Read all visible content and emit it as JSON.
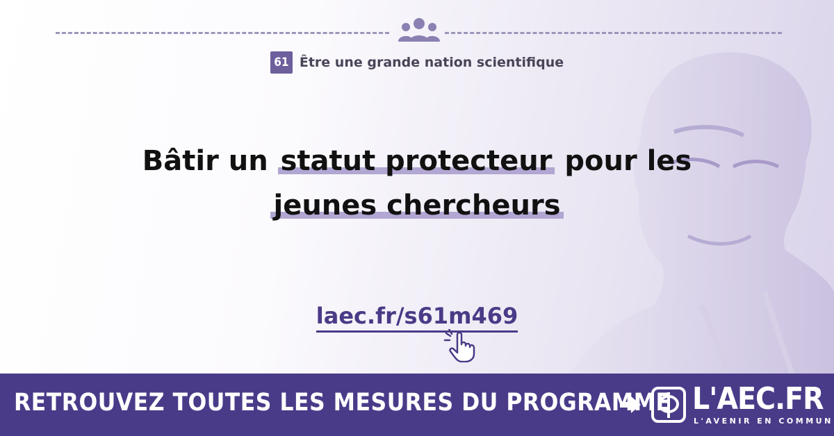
{
  "category": {
    "number": "61",
    "title": "Être une grande nation scientifique"
  },
  "headline": {
    "part1": "Bâtir un ",
    "highlight1": "statut protecteur",
    "part2": " pour les",
    "highlight2": "jeunes chercheurs"
  },
  "link": {
    "url_text": "laec.fr/s61m469"
  },
  "banner": {
    "text": "RETROUVEZ TOUTES LES MESURES DU PROGRAMME",
    "logo_text": "L'AEC.FR",
    "logo_subtitle": "L'AVENIR EN COMMUN"
  },
  "icons": {
    "top": "people-group-icon",
    "link": "pointing-hand-click-icon",
    "banner_arrow": "arrow-right-icon",
    "logo": "phi-logo-icon"
  },
  "colors": {
    "accent": "#4a3b89",
    "badge": "#6d5e9c",
    "highlight": "#b2a6d2",
    "rule": "#9e95bb"
  }
}
